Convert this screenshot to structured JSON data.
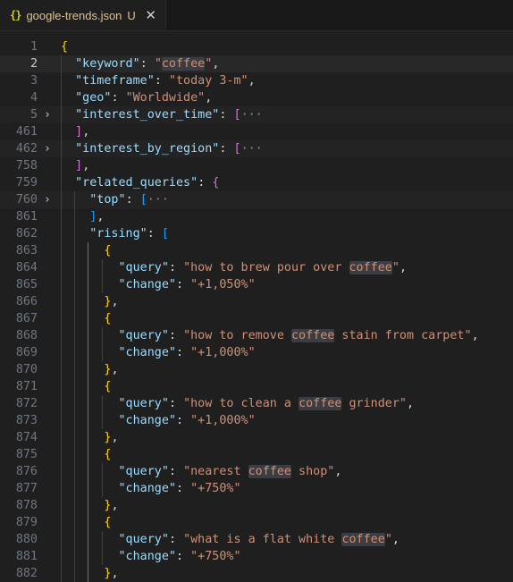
{
  "tab": {
    "icon_glyph": "{}",
    "icon_name": "json-file-icon",
    "file_name": "google-trends.json",
    "git_status": "U",
    "close_glyph": "✕"
  },
  "editor": {
    "search_highlight": "coffee",
    "lines": [
      {
        "n": "1",
        "tokens": [
          {
            "t": "{",
            "c": "b1"
          }
        ]
      },
      {
        "n": "2",
        "current": true,
        "tokens": [
          {
            "t": "  "
          },
          {
            "t": "\"keyword\"",
            "c": "p"
          },
          {
            "t": ": ",
            "c": "pu"
          },
          {
            "t": "\"coffee\"",
            "c": "s"
          },
          {
            "t": ",",
            "c": "pu"
          }
        ]
      },
      {
        "n": "3",
        "tokens": [
          {
            "t": "  "
          },
          {
            "t": "\"timeframe\"",
            "c": "p"
          },
          {
            "t": ": ",
            "c": "pu"
          },
          {
            "t": "\"today 3-m\"",
            "c": "s"
          },
          {
            "t": ",",
            "c": "pu"
          }
        ]
      },
      {
        "n": "4",
        "tokens": [
          {
            "t": "  "
          },
          {
            "t": "\"geo\"",
            "c": "p"
          },
          {
            "t": ": ",
            "c": "pu"
          },
          {
            "t": "\"Worldwide\"",
            "c": "s"
          },
          {
            "t": ",",
            "c": "pu"
          }
        ]
      },
      {
        "n": "5",
        "fold": true,
        "tokens": [
          {
            "t": "  "
          },
          {
            "t": "\"interest_over_time\"",
            "c": "p"
          },
          {
            "t": ": ",
            "c": "pu"
          },
          {
            "t": "[",
            "c": "b2"
          },
          {
            "t": "···",
            "c": "ell"
          }
        ]
      },
      {
        "n": "461",
        "tokens": [
          {
            "t": "  "
          },
          {
            "t": "]",
            "c": "b2"
          },
          {
            "t": ",",
            "c": "pu"
          }
        ]
      },
      {
        "n": "462",
        "fold": true,
        "tokens": [
          {
            "t": "  "
          },
          {
            "t": "\"interest_by_region\"",
            "c": "p"
          },
          {
            "t": ": ",
            "c": "pu"
          },
          {
            "t": "[",
            "c": "b2"
          },
          {
            "t": "···",
            "c": "ell"
          }
        ]
      },
      {
        "n": "758",
        "tokens": [
          {
            "t": "  "
          },
          {
            "t": "]",
            "c": "b2"
          },
          {
            "t": ",",
            "c": "pu"
          }
        ]
      },
      {
        "n": "759",
        "tokens": [
          {
            "t": "  "
          },
          {
            "t": "\"related_queries\"",
            "c": "p"
          },
          {
            "t": ": ",
            "c": "pu"
          },
          {
            "t": "{",
            "c": "b2"
          }
        ]
      },
      {
        "n": "760",
        "fold": true,
        "tokens": [
          {
            "t": "    "
          },
          {
            "t": "\"top\"",
            "c": "p"
          },
          {
            "t": ": ",
            "c": "pu"
          },
          {
            "t": "[",
            "c": "b3"
          },
          {
            "t": "···",
            "c": "ell"
          }
        ]
      },
      {
        "n": "861",
        "tokens": [
          {
            "t": "    "
          },
          {
            "t": "]",
            "c": "b3"
          },
          {
            "t": ",",
            "c": "pu"
          }
        ]
      },
      {
        "n": "862",
        "tokens": [
          {
            "t": "    "
          },
          {
            "t": "\"rising\"",
            "c": "p"
          },
          {
            "t": ": ",
            "c": "pu"
          },
          {
            "t": "[",
            "c": "b3"
          }
        ]
      },
      {
        "n": "863",
        "tokens": [
          {
            "t": "      "
          },
          {
            "t": "{",
            "c": "b1"
          }
        ]
      },
      {
        "n": "864",
        "tokens": [
          {
            "t": "        "
          },
          {
            "t": "\"query\"",
            "c": "p"
          },
          {
            "t": ": ",
            "c": "pu"
          },
          {
            "t": "\"how to brew pour over coffee\"",
            "c": "s"
          },
          {
            "t": ",",
            "c": "pu"
          }
        ]
      },
      {
        "n": "865",
        "tokens": [
          {
            "t": "        "
          },
          {
            "t": "\"change\"",
            "c": "p"
          },
          {
            "t": ": ",
            "c": "pu"
          },
          {
            "t": "\"+1,050%\"",
            "c": "s"
          }
        ]
      },
      {
        "n": "866",
        "tokens": [
          {
            "t": "      "
          },
          {
            "t": "}",
            "c": "b1"
          },
          {
            "t": ",",
            "c": "pu"
          }
        ]
      },
      {
        "n": "867",
        "tokens": [
          {
            "t": "      "
          },
          {
            "t": "{",
            "c": "b1"
          }
        ]
      },
      {
        "n": "868",
        "tokens": [
          {
            "t": "        "
          },
          {
            "t": "\"query\"",
            "c": "p"
          },
          {
            "t": ": ",
            "c": "pu"
          },
          {
            "t": "\"how to remove coffee stain from carpet\"",
            "c": "s"
          },
          {
            "t": ",",
            "c": "pu"
          }
        ]
      },
      {
        "n": "869",
        "tokens": [
          {
            "t": "        "
          },
          {
            "t": "\"change\"",
            "c": "p"
          },
          {
            "t": ": ",
            "c": "pu"
          },
          {
            "t": "\"+1,000%\"",
            "c": "s"
          }
        ]
      },
      {
        "n": "870",
        "tokens": [
          {
            "t": "      "
          },
          {
            "t": "}",
            "c": "b1"
          },
          {
            "t": ",",
            "c": "pu"
          }
        ]
      },
      {
        "n": "871",
        "tokens": [
          {
            "t": "      "
          },
          {
            "t": "{",
            "c": "b1"
          }
        ]
      },
      {
        "n": "872",
        "tokens": [
          {
            "t": "        "
          },
          {
            "t": "\"query\"",
            "c": "p"
          },
          {
            "t": ": ",
            "c": "pu"
          },
          {
            "t": "\"how to clean a coffee grinder\"",
            "c": "s"
          },
          {
            "t": ",",
            "c": "pu"
          }
        ]
      },
      {
        "n": "873",
        "tokens": [
          {
            "t": "        "
          },
          {
            "t": "\"change\"",
            "c": "p"
          },
          {
            "t": ": ",
            "c": "pu"
          },
          {
            "t": "\"+1,000%\"",
            "c": "s"
          }
        ]
      },
      {
        "n": "874",
        "tokens": [
          {
            "t": "      "
          },
          {
            "t": "}",
            "c": "b1"
          },
          {
            "t": ",",
            "c": "pu"
          }
        ]
      },
      {
        "n": "875",
        "tokens": [
          {
            "t": "      "
          },
          {
            "t": "{",
            "c": "b1"
          }
        ]
      },
      {
        "n": "876",
        "tokens": [
          {
            "t": "        "
          },
          {
            "t": "\"query\"",
            "c": "p"
          },
          {
            "t": ": ",
            "c": "pu"
          },
          {
            "t": "\"nearest coffee shop\"",
            "c": "s"
          },
          {
            "t": ",",
            "c": "pu"
          }
        ]
      },
      {
        "n": "877",
        "tokens": [
          {
            "t": "        "
          },
          {
            "t": "\"change\"",
            "c": "p"
          },
          {
            "t": ": ",
            "c": "pu"
          },
          {
            "t": "\"+750%\"",
            "c": "s"
          }
        ]
      },
      {
        "n": "878",
        "tokens": [
          {
            "t": "      "
          },
          {
            "t": "}",
            "c": "b1"
          },
          {
            "t": ",",
            "c": "pu"
          }
        ]
      },
      {
        "n": "879",
        "tokens": [
          {
            "t": "      "
          },
          {
            "t": "{",
            "c": "b1"
          }
        ]
      },
      {
        "n": "880",
        "tokens": [
          {
            "t": "        "
          },
          {
            "t": "\"query\"",
            "c": "p"
          },
          {
            "t": ": ",
            "c": "pu"
          },
          {
            "t": "\"what is a flat white coffee\"",
            "c": "s"
          },
          {
            "t": ",",
            "c": "pu"
          }
        ]
      },
      {
        "n": "881",
        "tokens": [
          {
            "t": "        "
          },
          {
            "t": "\"change\"",
            "c": "p"
          },
          {
            "t": ": ",
            "c": "pu"
          },
          {
            "t": "\"+750%\"",
            "c": "s"
          }
        ]
      },
      {
        "n": "882",
        "tokens": [
          {
            "t": "      "
          },
          {
            "t": "}",
            "c": "b1"
          },
          {
            "t": ",",
            "c": "pu"
          }
        ]
      }
    ]
  }
}
